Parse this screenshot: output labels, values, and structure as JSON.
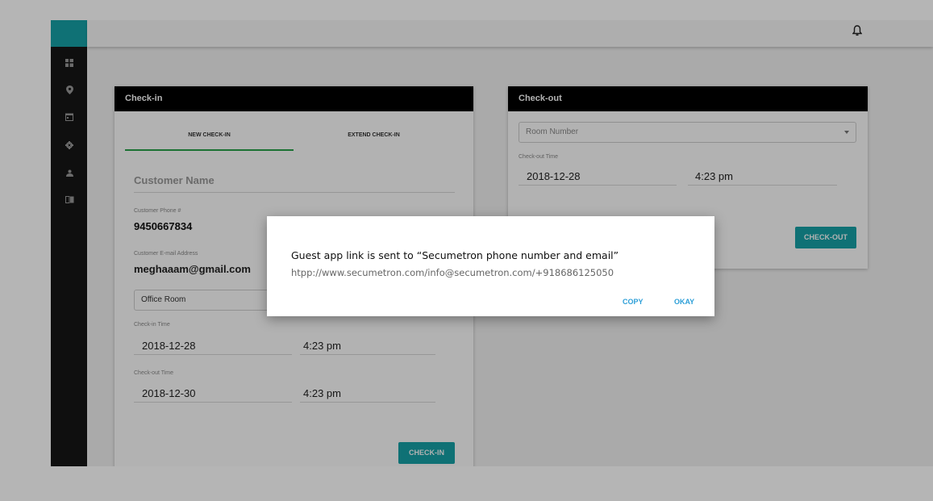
{
  "sidebar": {
    "icons": [
      "dashboard-icon",
      "location-pin-icon",
      "calendar-icon",
      "gear-icon",
      "person-icon",
      "book-icon"
    ]
  },
  "topbar": {
    "icon": "bell-icon"
  },
  "checkin": {
    "title": "Check-in",
    "tabs": [
      {
        "label": "NEW CHECK-IN",
        "active": true
      },
      {
        "label": "EXTEND CHECK-IN",
        "active": false
      }
    ],
    "customer_name_placeholder": "Customer Name",
    "phone_label": "Customer Phone #",
    "phone_value": "9450667834",
    "email_label": "Customer E-mail Address",
    "email_value": "meghaaam@gmail.com",
    "room_select_value": "Office Room",
    "checkin_time_label": "Check-in Time",
    "checkin_date": "2018-12-28",
    "checkin_time": "4:23 pm",
    "checkout_time_label": "Check-out Time",
    "checkout_date": "2018-12-30",
    "checkout_time": "4:23 pm",
    "button_label": "CHECK-IN"
  },
  "checkout": {
    "title": "Check-out",
    "room_placeholder": "Room Number",
    "checkout_time_label": "Check-out Time",
    "checkout_date": "2018-12-28",
    "checkout_time": "4:23 pm",
    "button_label": "CHECK-OUT"
  },
  "dialog": {
    "message": "Guest app link is sent to “Secumetron phone number and email”",
    "link": "htpp://www.secumetron.com/info@secumetron.com/+918686125050",
    "copy_label": "COPY",
    "okay_label": "OKAY"
  },
  "colors": {
    "accent": "#16a3a8",
    "tab_active": "#27a24a",
    "dialog_action": "#2d9fd8",
    "header": "#000000"
  }
}
